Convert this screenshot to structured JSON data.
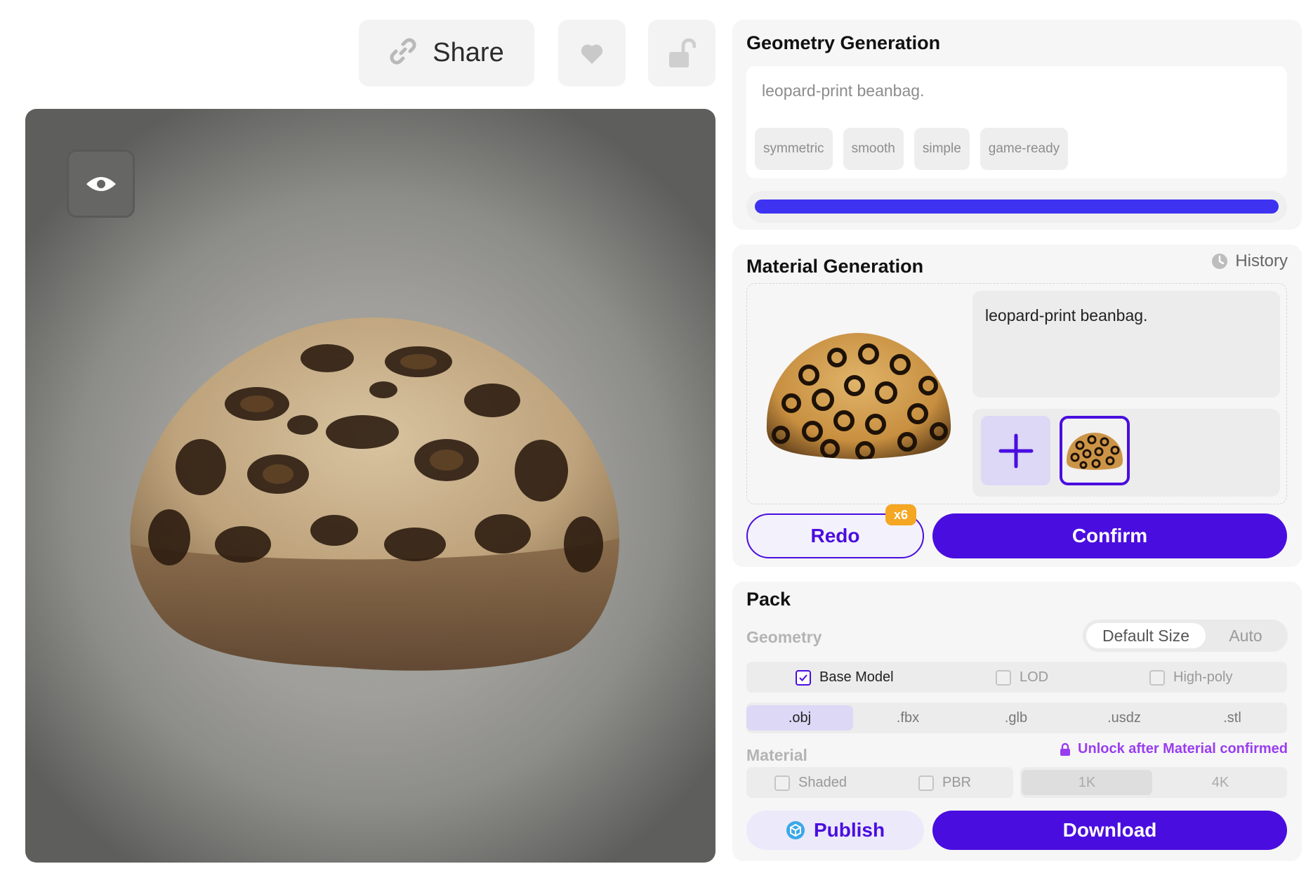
{
  "toolbar": {
    "share_label": "Share",
    "share_icon": "link-icon",
    "like_icon": "heart-icon",
    "lock_icon": "unlock-icon"
  },
  "viewer": {
    "eye_icon": "eye-icon",
    "model": "leopard-print beanbag 3D render"
  },
  "geometry": {
    "title": "Geometry Generation",
    "prompt": "leopard-print beanbag.",
    "tags": [
      "symmetric",
      "smooth",
      "simple",
      "game-ready"
    ],
    "progress": 1.0
  },
  "material": {
    "title": "Material Generation",
    "history_label": "History",
    "history_icon": "clock-icon",
    "prompt": "leopard-print beanbag.",
    "add_icon": "plus-icon",
    "redo_label": "Redo",
    "redo_badge": "x6",
    "confirm_label": "Confirm"
  },
  "pack": {
    "title": "Pack",
    "geometry_label": "Geometry",
    "size_options": [
      "Default Size",
      "Auto"
    ],
    "size_selected": "Default Size",
    "model_options": [
      {
        "label": "Base Model",
        "checked": true
      },
      {
        "label": "LOD",
        "checked": false
      },
      {
        "label": "High-poly",
        "checked": false
      }
    ],
    "formats": [
      ".obj",
      ".fbx",
      ".glb",
      ".usdz",
      ".stl"
    ],
    "format_selected": ".obj",
    "material_label": "Material",
    "unlock_note": "Unlock after Material confirmed",
    "material_options": [
      {
        "label": "Shaded",
        "checked": false
      },
      {
        "label": "PBR",
        "checked": false
      }
    ],
    "resolutions": [
      "1K",
      "4K"
    ],
    "resolution_selected": "1K",
    "publish_label": "Publish",
    "download_label": "Download"
  },
  "colors": {
    "accent": "#4a0ddf",
    "progress": "#3d33f0",
    "badge": "#f5a623",
    "unlock": "#9a3df0"
  }
}
